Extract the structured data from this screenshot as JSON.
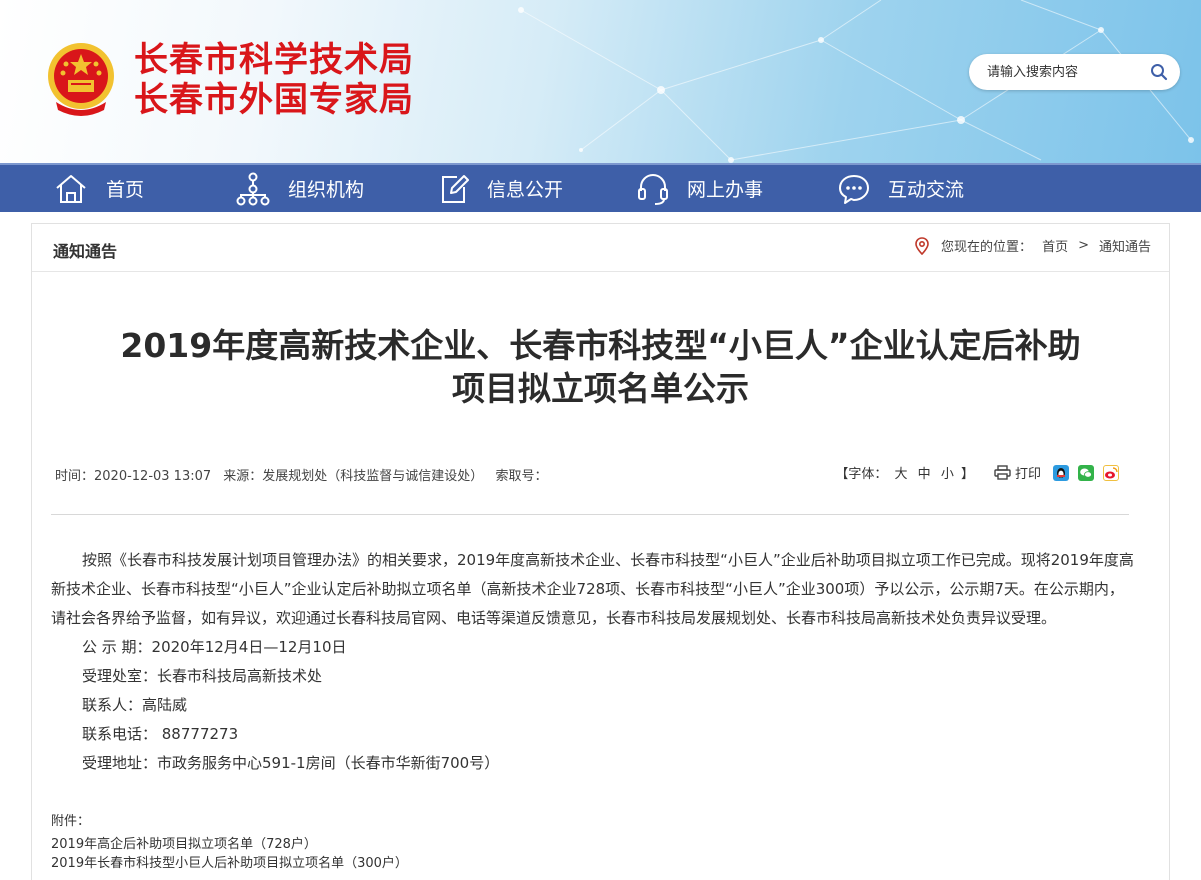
{
  "header": {
    "title_line1": "长春市科学技术局",
    "title_line2": "长春市外国专家局",
    "search_placeholder": "请输入搜索内容",
    "title_color": "#d9161a"
  },
  "nav": {
    "items": [
      {
        "label": "首页",
        "icon": "home-icon"
      },
      {
        "label": "组织机构",
        "icon": "org-chart-icon"
      },
      {
        "label": "信息公开",
        "icon": "edit-icon"
      },
      {
        "label": "网上办事",
        "icon": "headset-icon"
      },
      {
        "label": "互动交流",
        "icon": "chat-icon"
      }
    ],
    "bg_color": "#3e5fa8"
  },
  "panel": {
    "title": "通知通告",
    "breadcrumb": {
      "prefix": "您现在的位置：",
      "home": "首页",
      "separator": ">",
      "current": "通知通告"
    }
  },
  "article": {
    "title_line1": "2019年度高新技术企业、长春市科技型“小巨人”企业认定后补助",
    "title_line2": "项目拟立项名单公示",
    "meta": {
      "time": "时间：2020-12-03 13:07",
      "source": "来源：发展规划处（科技监督与诚信建设处）",
      "index": "索取号："
    },
    "tools": {
      "font_label_open": "【字体：",
      "font_large": "大",
      "font_medium": "中",
      "font_small": "小",
      "font_label_close": "】",
      "print": "打印"
    },
    "paragraph": "按照《长春市科技发展计划项目管理办法》的相关要求，2019年度高新技术企业、长春市科技型“小巨人”企业后补助项目拟立项工作已完成。现将2019年度高新技术企业、长春市科技型“小巨人”企业认定后补助拟立项名单（高新技术企业728项、长春市科技型“小巨人”企业300项）予以公示，公示期7天。在公示期内，请社会各界给予监督，如有异议，欢迎通过长春科技局官网、电话等渠道反馈意见，长春市科技局发展规划处、长春市科技局高新技术处负责异议受理。",
    "lines": [
      "公 示 期：2020年12月4日—12月10日",
      "受理处室：长春市科技局高新技术处",
      "联系人：高陆威",
      "联系电话：  88777273",
      "受理地址：市政务服务中心591-1房间（长春市华新街700号）"
    ],
    "attachments_label": "附件：",
    "attachments": [
      "2019年高企后补助项目拟立项名单（728户）",
      "2019年长春市科技型小巨人后补助项目拟立项名单（300户）"
    ]
  }
}
